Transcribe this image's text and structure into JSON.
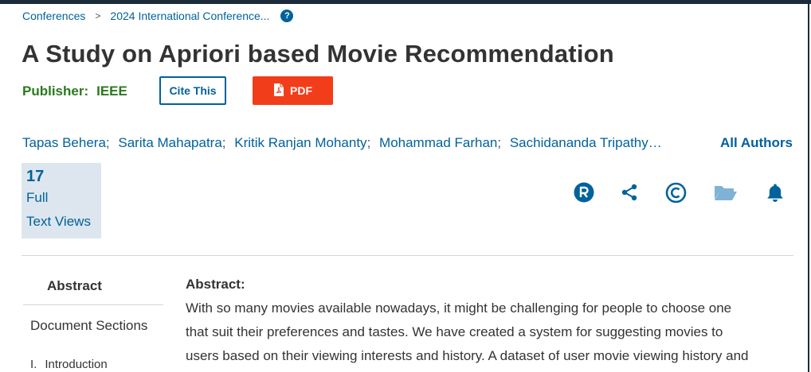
{
  "breadcrumb": {
    "items": [
      "Conferences",
      "2024 International Conference..."
    ],
    "separator": ">",
    "help_glyph": "?"
  },
  "paper": {
    "title": "A Study on Apriori based Movie Recommendation",
    "publisher_label": "Publisher:",
    "publisher_name": "IEEE"
  },
  "actions": {
    "cite_label": "Cite This",
    "pdf_label": "PDF"
  },
  "authors": {
    "list": [
      "Tapas Behera",
      "Sarita Mahapatra",
      "Kritik Ranjan Mohanty",
      "Mohammad Farhan",
      "Sachidananda Tripathy…"
    ],
    "separator": ";",
    "all_label": "All Authors"
  },
  "metrics": {
    "count": "17",
    "label_line1": "Full",
    "label_line2": "Text Views"
  },
  "toolbar_icons": [
    "rights-icon",
    "share-icon",
    "copyright-icon",
    "folder-icon",
    "bell-icon"
  ],
  "sidebar": {
    "abstract_label": "Abstract",
    "doc_sections_label": "Document Sections",
    "intro_number": "I.",
    "intro_label": "Introduction"
  },
  "abstract": {
    "heading": "Abstract:",
    "lines": [
      "With so many movies available nowadays, it might be challenging for people to choose one",
      "that suit their preferences and tastes. We have created a system for suggesting movies to",
      "users based on their viewing interests and history. A dataset of user movie viewing history and"
    ]
  },
  "colors": {
    "link": "#00629b",
    "publisher": "#2a7a1c",
    "pdf_button": "#f23d1b",
    "metrics_bg": "#dde6ee",
    "top_bar": "#1c2b39"
  }
}
